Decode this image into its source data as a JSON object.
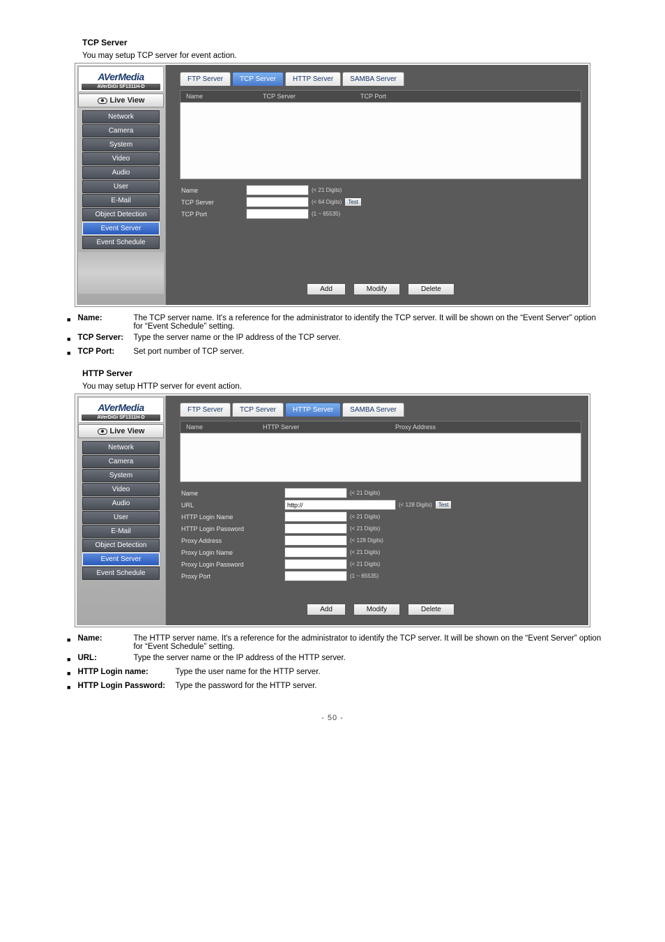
{
  "section1": {
    "heading": "TCP Server",
    "intro": "You may setup TCP server for event action.",
    "brand": {
      "main": "AVerMedia",
      "sub": "AVerDiGi SF1311H-D"
    },
    "liveview": "Live View",
    "nav": [
      "Network",
      "Camera",
      "System",
      "Video",
      "Audio",
      "User",
      "E-Mail",
      "Object Detection",
      "Event Server",
      "Event Schedule"
    ],
    "activeNav": "Event Server",
    "tabs": [
      "FTP Server",
      "TCP Server",
      "HTTP Server",
      "SAMBA Server"
    ],
    "activeTab": "TCP Server",
    "listHeaders": [
      "Name",
      "TCP Server",
      "TCP Port"
    ],
    "form": {
      "name": {
        "label": "Name",
        "hint": "(< 21 Digits)"
      },
      "tcpServer": {
        "label": "TCP Server",
        "hint": "(< 64 Digits)",
        "test": "Test"
      },
      "tcpPort": {
        "label": "TCP Port",
        "hint": "(1 ~ 65535)"
      }
    },
    "buttons": {
      "add": "Add",
      "modify": "Modify",
      "delete": "Delete"
    },
    "bullets": [
      {
        "label": "Name:",
        "body": "The TCP server name. It's a reference for the administrator to identify the TCP server. It will be shown on the “Event Server” option for “Event Schedule” setting."
      },
      {
        "label": "TCP Server:",
        "body": "Type the server name or the IP address of the TCP server."
      },
      {
        "label": "TCP Port:",
        "body": "Set port number of TCP server."
      }
    ]
  },
  "section2": {
    "heading": "HTTP Server",
    "intro": "You may setup HTTP server for event action.",
    "tabs": [
      "FTP Server",
      "TCP Server",
      "HTTP Server",
      "SAMBA Server"
    ],
    "activeTab": "HTTP Server",
    "listHeaders": [
      "Name",
      "HTTP Server",
      "Proxy Address"
    ],
    "form": {
      "name": {
        "label": "Name",
        "hint": "(< 21 Digits)"
      },
      "url": {
        "label": "URL",
        "value": "http://",
        "hint": "(< 128 Digits)",
        "test": "Test"
      },
      "httpLogin": {
        "label": "HTTP Login Name",
        "hint": "(< 21 Digits)"
      },
      "httpPass": {
        "label": "HTTP Login Password",
        "hint": "(< 21 Digits)"
      },
      "proxyAddr": {
        "label": "Proxy Address",
        "hint": "(< 128 Digits)"
      },
      "proxyLogin": {
        "label": "Proxy Login Name",
        "hint": "(< 21 Digits)"
      },
      "proxyPass": {
        "label": "Proxy Login Password",
        "hint": "(< 21 Digits)"
      },
      "proxyPort": {
        "label": "Proxy Port",
        "hint": "(1 ~ 65535)"
      }
    },
    "bullets": [
      {
        "label": "Name:",
        "body": "The HTTP server name. It's a reference for the administrator to identify the TCP server. It will be shown on the “Event Server” option for “Event Schedule” setting."
      },
      {
        "label": "URL:",
        "body": "Type the server name or the IP address of the HTTP server."
      },
      {
        "label": "HTTP Login name:",
        "body": "Type the user name for the HTTP server."
      },
      {
        "label": "HTTP Login Password:",
        "body": "Type the password for the HTTP server."
      }
    ]
  },
  "pageNumber": "- 50 -"
}
